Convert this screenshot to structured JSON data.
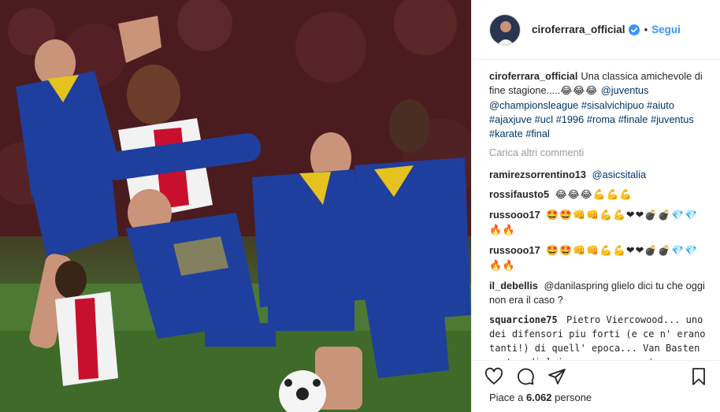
{
  "header": {
    "username": "ciroferrara_official",
    "separator": "•",
    "follow_label": "Segui"
  },
  "caption": {
    "username": "ciroferrara_official",
    "text": "Una classica amichevole di fine stagione.....",
    "emojis": "😂😂😂",
    "hashtags": [
      "@juventus",
      "@championsleague",
      "#sisalvichipuo",
      "#aiuto",
      "#ajaxjuve",
      "#ucl",
      "#1996",
      "#roma",
      "#finale",
      "#juventus",
      "#karate",
      "#final"
    ]
  },
  "load_more_label": "Carica altri commenti",
  "comments": [
    {
      "username": "ramirezsorrentino13",
      "text": "@asicsitalia"
    },
    {
      "username": "rossifausto5",
      "text": "😂😂😂💪💪💪"
    },
    {
      "username": "russooo17",
      "text": "🤩🤩👊👊💪💪❤❤💣💣💎💎🔥🔥"
    },
    {
      "username": "russooo17",
      "text": "🤩🤩👊👊💪💪❤❤💣💣💎💎🔥🔥"
    },
    {
      "username": "il_debellis",
      "text": "@danilaspring glielo dici tu che oggi non era il caso ?"
    },
    {
      "username": "squarcione75",
      "text": "Pietro Viercowood... uno dei difensori piu forti (e ce n' erano tanti!) di quell' epoca... Van Basten contro di lui nonave veramente tanto... mentre Caress lo"
    }
  ],
  "likes": {
    "prefix": "Piace a",
    "count": "6.062",
    "suffix": "persone"
  },
  "icons": {
    "like": "heart-icon",
    "comment": "comment-bubble-icon",
    "share": "share-icon",
    "save": "bookmark-icon",
    "verified": "verified-badge-icon"
  },
  "colors": {
    "link_blue": "#3897f0",
    "hashtag": "#003569",
    "muted": "#999999",
    "juve_blue": "#1f3f9e",
    "juve_yellow": "#e6c21e",
    "ajax_red": "#c8102e"
  }
}
